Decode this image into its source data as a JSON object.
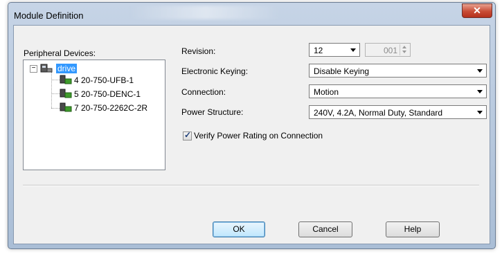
{
  "window": {
    "title": "Module Definition",
    "close_glyph": "✕"
  },
  "peripheral": {
    "label": "Peripheral Devices:",
    "tree": {
      "root": {
        "label": "drive",
        "expander": "−",
        "icon": "drive-node-icon"
      },
      "children": [
        {
          "label": "4 20-750-UFB-1",
          "icon": "peripheral-module-icon"
        },
        {
          "label": "5 20-750-DENC-1",
          "icon": "peripheral-module-icon"
        },
        {
          "label": "7 20-750-2262C-2R",
          "icon": "peripheral-module-icon"
        }
      ]
    }
  },
  "revision": {
    "label": "Revision:",
    "major": "12",
    "minor": "001"
  },
  "keying": {
    "label": "Electronic Keying:",
    "value": "Disable Keying"
  },
  "connection": {
    "label": "Connection:",
    "value": "Motion"
  },
  "power_structure": {
    "label": "Power Structure:",
    "value": "240V, 4.2A, Normal Duty, Standard"
  },
  "verify": {
    "label": "Verify Power Rating on Connection",
    "checked": true,
    "check_glyph": "✓"
  },
  "buttons": {
    "ok": "OK",
    "cancel": "Cancel",
    "help": "Help"
  }
}
